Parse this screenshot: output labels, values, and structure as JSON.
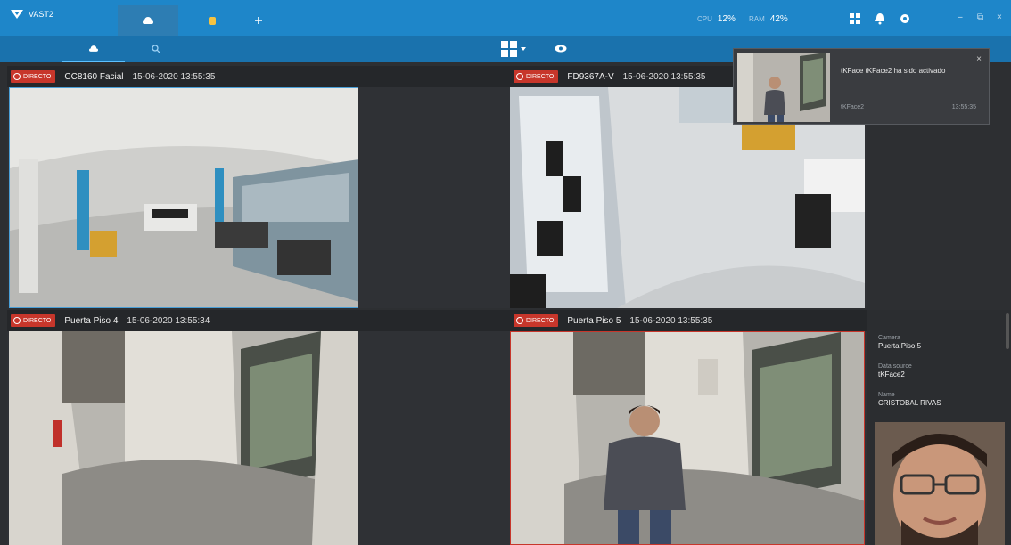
{
  "app": {
    "name": "VAST2"
  },
  "metrics": {
    "cpu_label": "CPU",
    "cpu_value": "12%",
    "mem_label": "RAM",
    "mem_value": "42%"
  },
  "cameras": [
    {
      "badge": "DIRECTO",
      "name": "CC8160 Facial",
      "timestamp": "15-06-2020 13:55:35"
    },
    {
      "badge": "DIRECTO",
      "name": "FD9367A-V",
      "timestamp": "15-06-2020 13:55:35"
    },
    {
      "badge": "DIRECTO",
      "name": "Puerta Piso 4",
      "timestamp": "15-06-2020 13:55:34"
    },
    {
      "badge": "DIRECTO",
      "name": "Puerta Piso 5",
      "timestamp": "15-06-2020 13:55:35"
    }
  ],
  "notification": {
    "message": "tKFace tKFace2 ha sido activado",
    "source": "tKFace2",
    "time": "13:55:35"
  },
  "detail": {
    "camera_label": "Camera",
    "camera_value": "Puerta Piso 5",
    "db_label": "Data source",
    "db_value": "tKFace2",
    "name_label": "Name",
    "name_value": "CRISTOBAL RIVAS"
  },
  "colors": {
    "topbar": "#1e86c9",
    "live": "#c7362b",
    "accent": "#4a9fd7"
  }
}
